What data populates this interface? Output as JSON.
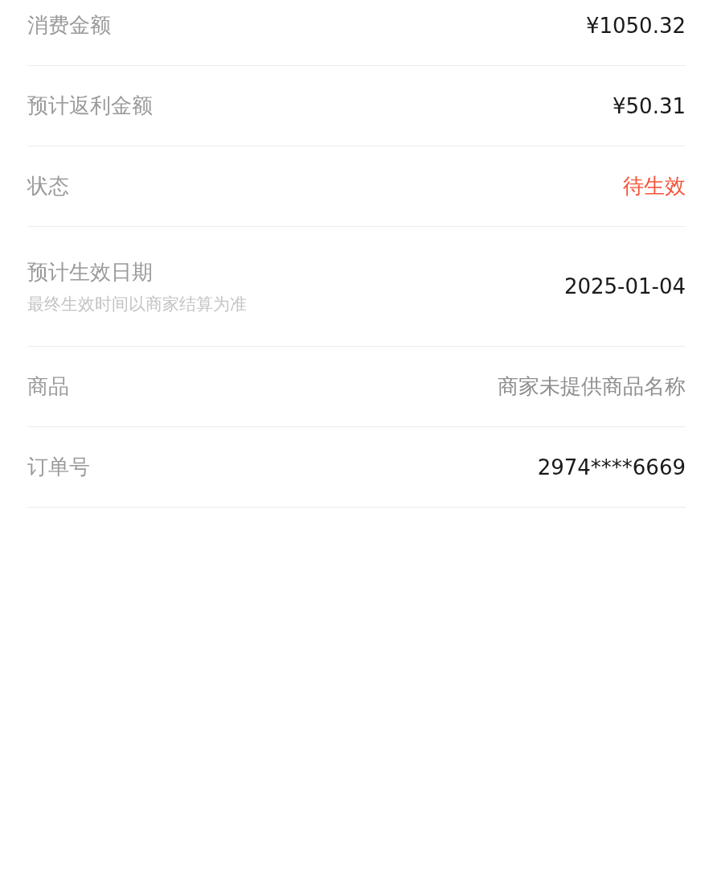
{
  "rows": [
    {
      "label": "消费金额",
      "value": "¥1050.32",
      "highlight": false
    },
    {
      "label": "预计返利金额",
      "value": "¥50.31",
      "highlight": false
    },
    {
      "label": "状态",
      "value": "待生效",
      "highlight": true
    },
    {
      "label": "预计生效日期",
      "note": "最终生效时间以商家结算为准",
      "value": "2025-01-04",
      "highlight": false
    },
    {
      "label": "商品",
      "value": "商家未提供商品名称",
      "highlight": false,
      "muted": true
    },
    {
      "label": "订单号",
      "value": "2974****6669",
      "highlight": false
    }
  ]
}
